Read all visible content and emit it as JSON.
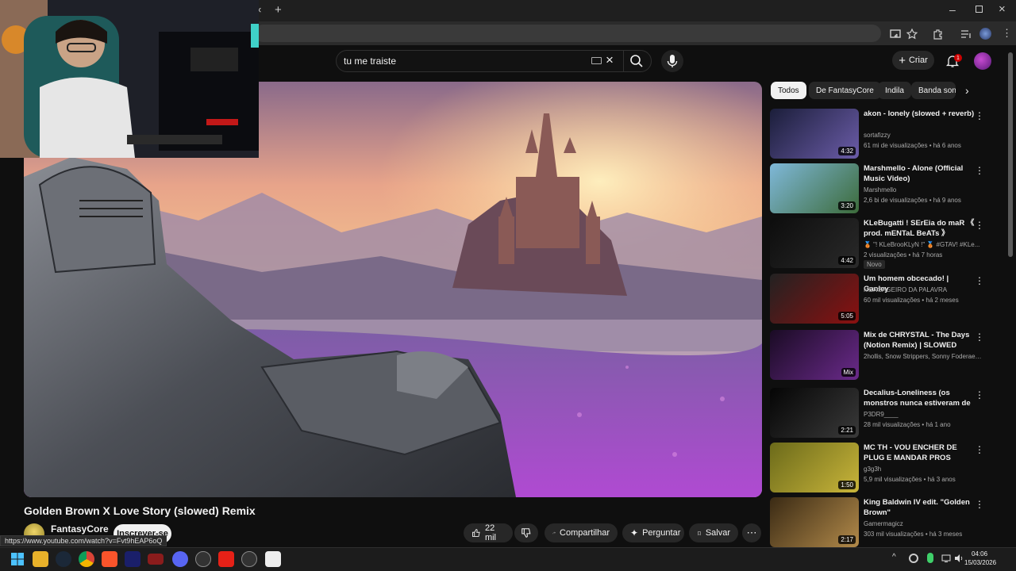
{
  "browser": {
    "tab_close": "×",
    "new_tab": "+"
  },
  "search": {
    "value": "tu me traiste"
  },
  "header": {
    "create_label": "Criar",
    "notification_count": "1"
  },
  "video": {
    "title": "Golden Brown X Love Story (slowed) Remix",
    "channel": "FantasyCore",
    "subscribe_label": "Inscrever-se",
    "likes": "22 mil",
    "share_label": "Compartilhar",
    "ask_label": "Perguntar",
    "save_label": "Salvar",
    "status_url": "https://www.youtube.com/watch?v=Fvt9hEAP6oQ"
  },
  "chips": [
    "Todos",
    "De FantasyCore",
    "Indila",
    "Banda son"
  ],
  "recommendations": [
    {
      "title": "akon - lonely (slowed + reverb)",
      "channel": "sortafizzy",
      "stats": "61 mi de visualizações • há 6 anos",
      "duration": "4:32",
      "colors": [
        "#1b1e3a",
        "#6b5ca8"
      ]
    },
    {
      "title": "Marshmello - Alone (Official Music Video)",
      "channel": "Marshmello",
      "stats": "2,6 bi de visualizações • há 9 anos",
      "duration": "3:20",
      "colors": [
        "#7fb8d9",
        "#3c6b3a"
      ]
    },
    {
      "title": "KLeBugatti ! SErEia do maR 《 prod. mENTaL BeATs 》",
      "channel": "🥉 \"! KLeBrooKLyN !\" 🥉 #GTAV! #KLe...",
      "stats": "2 visualizações • há 7 horas",
      "badge": "Novo",
      "duration": "4:42",
      "colors": [
        "#0d0d0d",
        "#2a2a2a"
      ]
    },
    {
      "title": "Um homem obcecado! | Ganley",
      "channel": "MENSAGEIRO DA PALAVRA",
      "stats": "60 mil visualizações • há 2 meses",
      "duration": "5:05",
      "colors": [
        "#222",
        "#8b1010"
      ]
    },
    {
      "title": "Mix de CHRYSTAL - The Days (Notion Remix) | SLOWED",
      "channel": "2hollis, Snow Strippers, Sonny Foderae o...",
      "stats": "",
      "duration": "Mix",
      "colors": [
        "#1a0b24",
        "#6a2a8a"
      ]
    },
    {
      "title": "Decalius-Loneliness (os monstros nunca estiveram de ...",
      "channel": "P3DR9____",
      "stats": "28 mil visualizações • há 1 ano",
      "duration": "2:21",
      "colors": [
        "#050505",
        "#3a3a3a"
      ]
    },
    {
      "title": "MC TH - VOU ENCHER DE PLUG E MANDAR PROS ALEMÃO 🧚 ...",
      "channel": "g3g3h",
      "stats": "5,9 mil visualizações • há 3 anos",
      "duration": "1:50",
      "colors": [
        "#6b6a1a",
        "#c9b53a"
      ]
    },
    {
      "title": "King Baldwin IV edit. \"Golden Brown\"",
      "channel": "Gamermagicz",
      "stats": "303 mil visualizações • há 3 meses",
      "duration": "2:17",
      "colors": [
        "#3a2a14",
        "#b28a4a"
      ]
    }
  ],
  "taskbar": {
    "time": "04:06",
    "date": "15/03/2026"
  }
}
